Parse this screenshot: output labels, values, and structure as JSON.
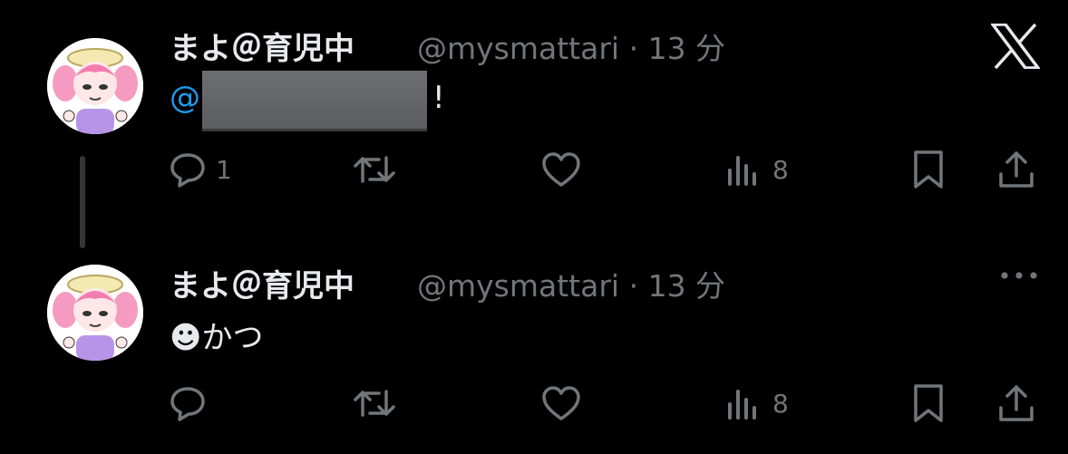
{
  "tweets": [
    {
      "display_name": "まよ＠育児中",
      "handle": "@mysmattari",
      "separator": "·",
      "time": "13 分",
      "mention": "@",
      "text_after": "!",
      "actions": {
        "reply_count": "1",
        "views_count": "8"
      }
    },
    {
      "display_name": "まよ＠育児中",
      "handle": "@mysmattari",
      "separator": "·",
      "time": "13 分",
      "emoji": "☻",
      "text": "かつ",
      "actions": {
        "reply_count": "",
        "views_count": "8"
      }
    }
  ],
  "icons": [
    "x-logo",
    "reply-icon",
    "retweet-icon",
    "like-icon",
    "views-icon",
    "bookmark-icon",
    "share-icon",
    "more-icon"
  ],
  "colors": {
    "background": "#000000",
    "text": "#e7e9ea",
    "secondary": "#71767b",
    "mention": "#1d9bf0"
  }
}
